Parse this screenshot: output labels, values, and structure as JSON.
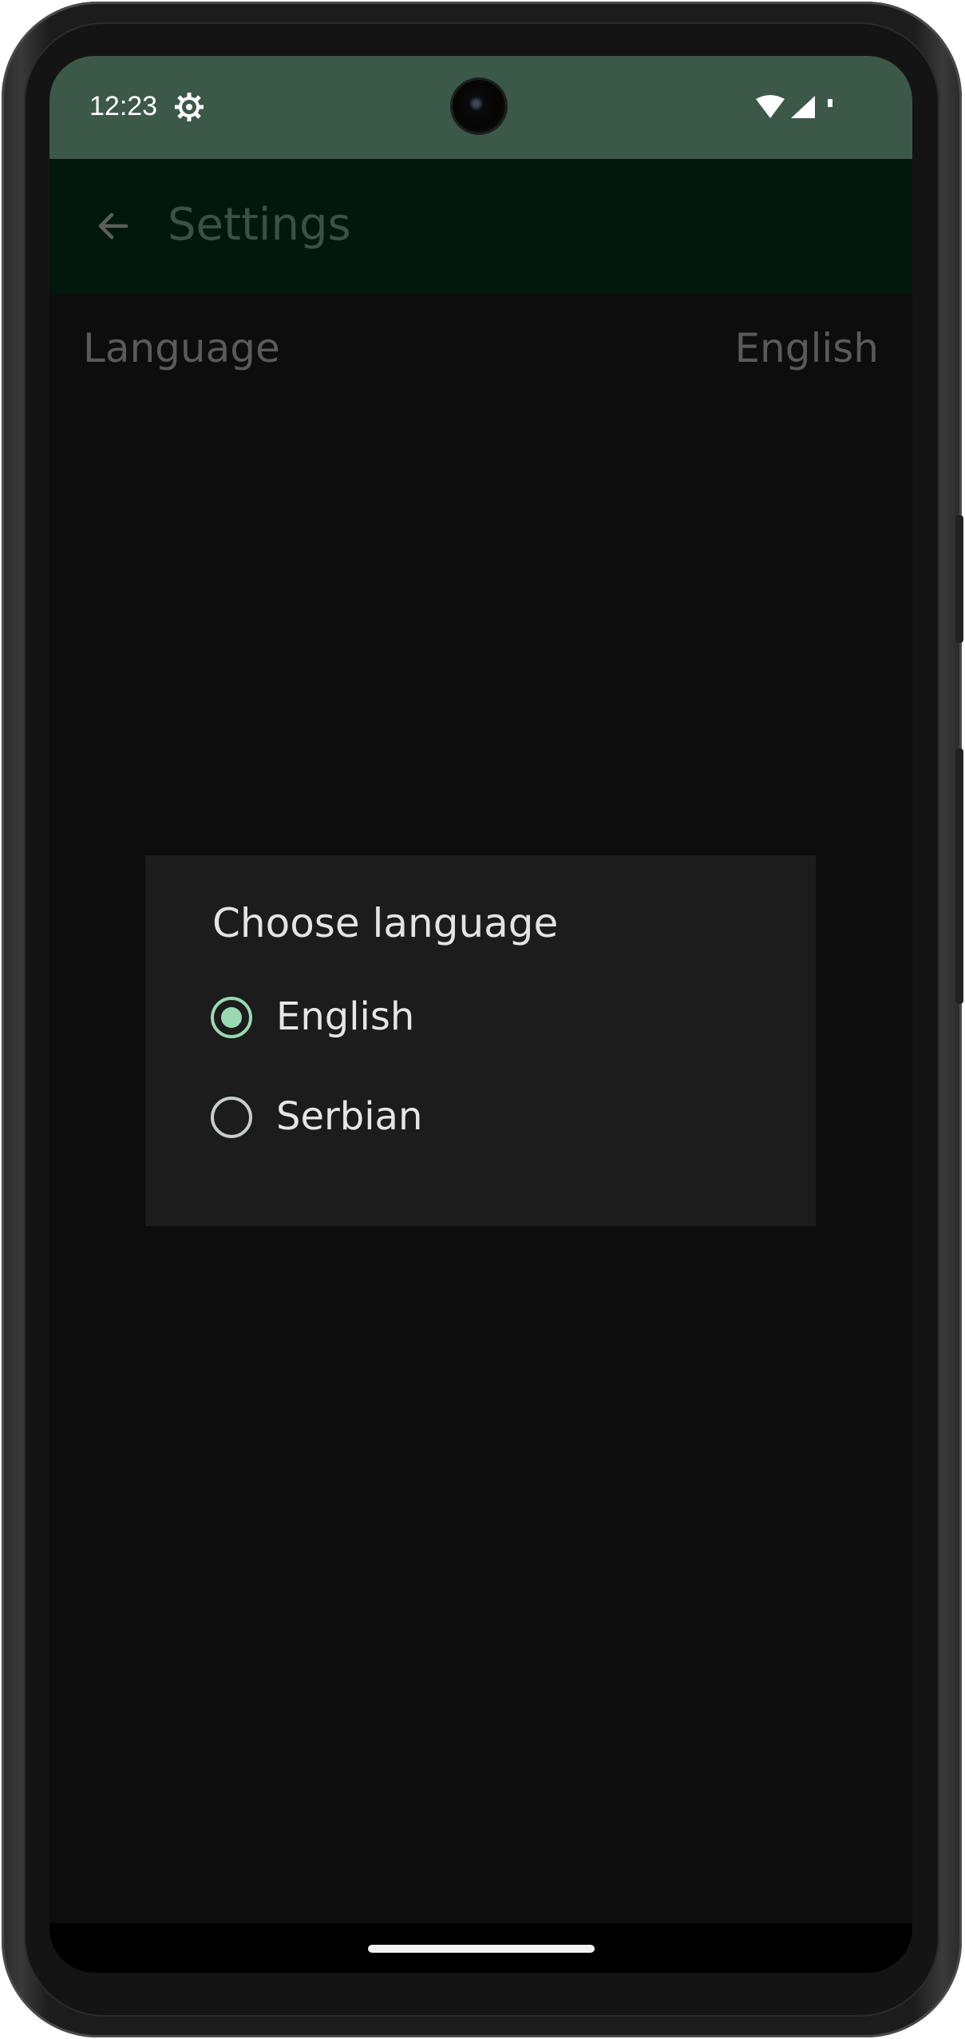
{
  "status_bar": {
    "time": "12:23",
    "icons": [
      "settings-gear-icon",
      "wifi-icon",
      "cellular-signal-icon",
      "battery-icon"
    ]
  },
  "app_bar": {
    "back_icon": "arrow-back-icon",
    "title": "Settings"
  },
  "settings": {
    "language_label": "Language",
    "language_value": "English"
  },
  "dialog": {
    "title": "Choose language",
    "options": [
      {
        "label": "English",
        "selected": true
      },
      {
        "label": "Serbian",
        "selected": false
      }
    ]
  },
  "colors": {
    "status_bar_bg": "#3c5849",
    "app_bar_bg": "#02180f",
    "background": "#0d0d0d",
    "dialog_bg": "#1b1c1b",
    "accent": "#9bd9b2"
  }
}
